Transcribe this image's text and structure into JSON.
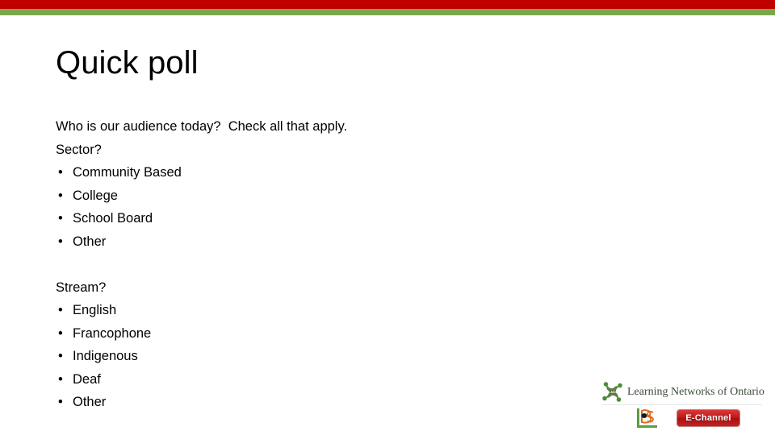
{
  "slide": {
    "title": "Quick poll",
    "lead": "Who is our audience today?  Check all that apply.",
    "sections": [
      {
        "question": "Sector?",
        "options": [
          "Community Based",
          "College",
          "School Board",
          "Other"
        ]
      },
      {
        "question": "Stream?",
        "options": [
          "English",
          "Francophone",
          "Indigenous",
          "Deaf",
          "Other"
        ]
      }
    ]
  },
  "decor": {
    "band_red_color": "#c00000",
    "band_green_color": "#77a94c"
  },
  "logos": {
    "lno": {
      "icon": "pinwheel-people-icon",
      "text": "Learning Networks of Ontario",
      "color": "#3d4b3a",
      "accent": "#4e8b3c"
    },
    "lbs": {
      "icon": "lbs-monogram-icon",
      "green": "#5a9e3f",
      "orange": "#e06a1b"
    },
    "echannel": {
      "text": "E-Channel",
      "background": "#c01818",
      "text_color": "#ffffff"
    }
  }
}
